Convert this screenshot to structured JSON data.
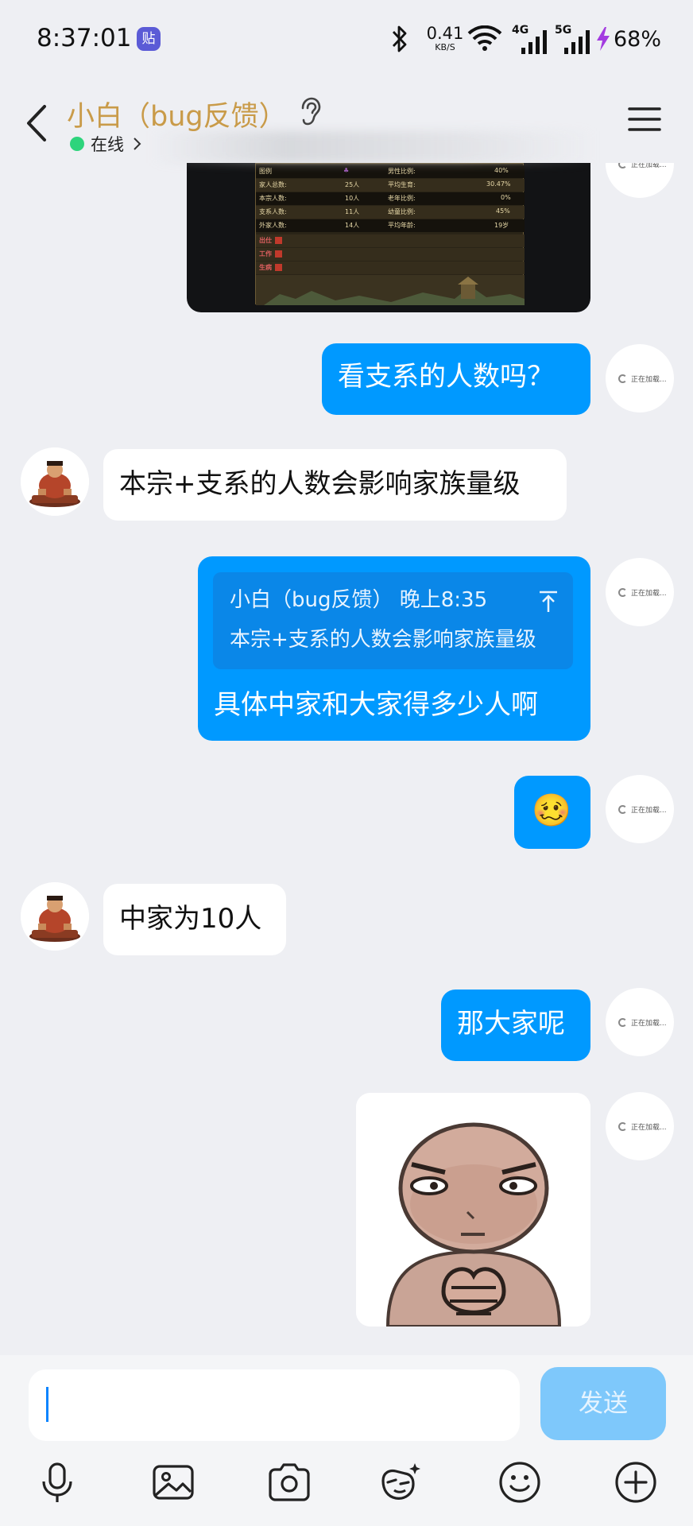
{
  "status_bar": {
    "time": "8:37:01",
    "sticker_app_glyph": "贴",
    "net_speed_value": "0.41",
    "net_speed_unit": "KB/S",
    "net_4g": "4G",
    "net_5g": "5G",
    "battery": "68%",
    "icons": [
      "bluetooth-icon",
      "wifi-icon",
      "signal-4g-icon",
      "signal-5g-icon",
      "charging-bolt-icon"
    ]
  },
  "header": {
    "title": "小白（bug反馈）",
    "status": "在线",
    "icons": [
      "back-icon",
      "ear-icon",
      "menu-icon"
    ]
  },
  "game_stats": {
    "rows": [
      {
        "l": "图例",
        "r": "男性比例:",
        "v": "40%"
      },
      {
        "l": "家人总数:",
        "lv": "25人",
        "r": "平均生育:",
        "v": "30.47%"
      },
      {
        "l": "本宗人数:",
        "lv": "10人",
        "r": "老年比例:",
        "v": "0%"
      },
      {
        "l": "支系人数:",
        "lv": "11人",
        "r": "幼童比例:",
        "v": "45%"
      },
      {
        "l": "外家人数:",
        "lv": "14人",
        "r": "平均年龄:",
        "v": "19岁"
      },
      {
        "l": "出仕"
      },
      {
        "l": "工作"
      },
      {
        "l": "生病"
      }
    ]
  },
  "messages": {
    "m1": "看支系的人数吗？",
    "m2": "本宗+支系的人数会影响家族量级",
    "m3_quote_header": "小白（bug反馈） 晚上8:35",
    "m3_quote_text": "本宗+支系的人数会影响家族量级",
    "m3_text": "具体中家和大家得多少人啊",
    "m4_emoji": "🥴",
    "m5": "中家为10人",
    "m6": "那大家呢",
    "avatar_loading": "正在加载..."
  },
  "input": {
    "value": "",
    "send_label": "发送"
  },
  "toolbar": [
    "microphone-icon",
    "image-icon",
    "camera-icon",
    "sticker-icon",
    "emoji-icon",
    "plus-icon"
  ],
  "colors": {
    "accent": "#0099ff",
    "title": "#c99b49",
    "background": "#eeeff3",
    "online": "#2ed47c",
    "send_disabled": "#7ec8fb"
  }
}
